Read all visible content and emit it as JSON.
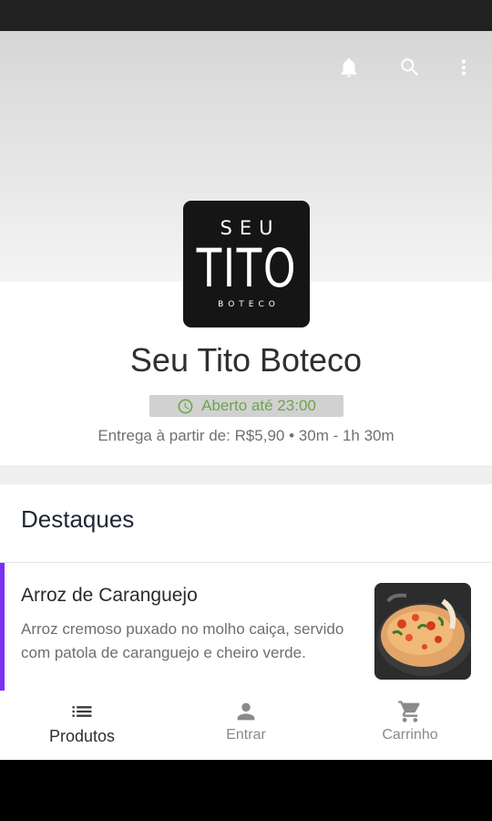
{
  "toolbar": {
    "icons": [
      "bell-icon",
      "search-icon",
      "more-vert-icon"
    ]
  },
  "store": {
    "logo": {
      "line1": "SEU",
      "line2": "TITO",
      "line3": "BOTECO"
    },
    "name": "Seu Tito Boteco",
    "status": "Aberto até 23:00",
    "delivery": "Entrega à partir de: R$5,90 • 30m - 1h 30m"
  },
  "highlights": {
    "title": "Destaques",
    "items": [
      {
        "title": "Arroz de Caranguejo",
        "description": "Arroz cremoso puxado no molho caiça, servido com patola de caranguejo e cheiro verde."
      }
    ]
  },
  "nav": {
    "products": "Produtos",
    "login": "Entrar",
    "cart": "Carrinho"
  },
  "colors": {
    "accent": "#7b2ff2",
    "open_status": "#6da54d",
    "status_bar": "#212121"
  }
}
